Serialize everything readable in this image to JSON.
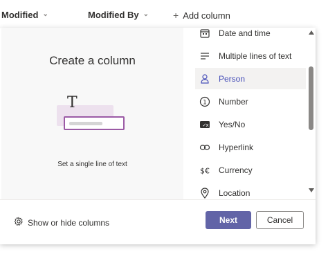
{
  "header": {
    "modified_label": "Modified",
    "modified_by_label": "Modified By",
    "add_column_label": "Add column"
  },
  "preview": {
    "title": "Create a column",
    "illustration_letter": "T",
    "description": "Set a single line of text"
  },
  "column_types": [
    {
      "label": "Date and time",
      "icon": "calendar-icon"
    },
    {
      "label": "Multiple lines of text",
      "icon": "lines-icon"
    },
    {
      "label": "Person",
      "icon": "person-icon",
      "selected": true
    },
    {
      "label": "Number",
      "icon": "number-icon"
    },
    {
      "label": "Yes/No",
      "icon": "toggle-icon"
    },
    {
      "label": "Hyperlink",
      "icon": "link-icon"
    },
    {
      "label": "Currency",
      "icon": "currency-icon"
    },
    {
      "label": "Location",
      "icon": "location-icon"
    }
  ],
  "footer": {
    "show_hide_label": "Show or hide columns",
    "next_label": "Next",
    "cancel_label": "Cancel"
  },
  "colors": {
    "accent": "#6264a7",
    "selected_text": "#464eb8",
    "illustration_border": "#9b5aa5",
    "illustration_fill": "#ede1ee"
  }
}
